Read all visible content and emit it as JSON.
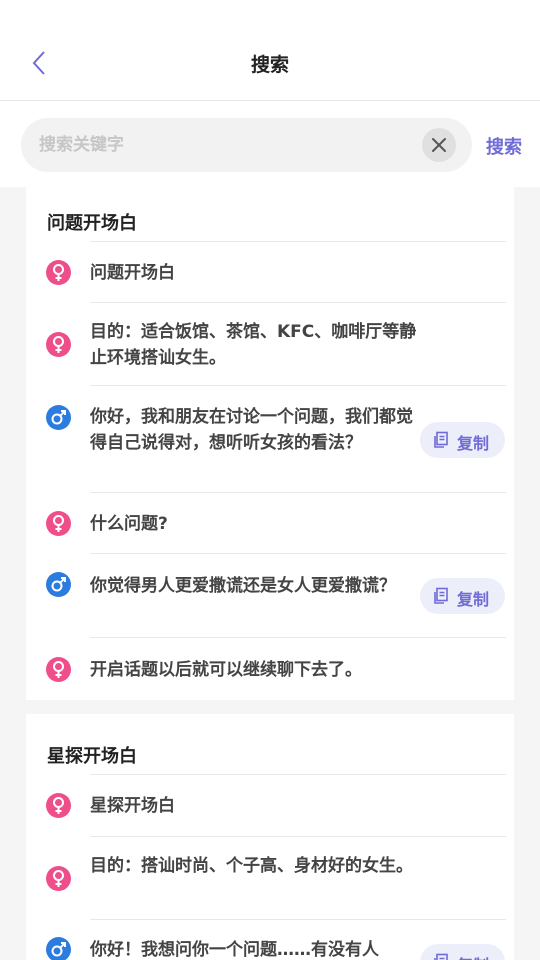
{
  "header": {
    "title": "搜索"
  },
  "search": {
    "placeholder": "搜索关键字",
    "button": "搜索"
  },
  "copy_label": "复制",
  "cards": [
    {
      "title": "问题开场白",
      "rows": [
        {
          "gender": "female",
          "text": "问题开场白"
        },
        {
          "gender": "female",
          "text": "目的：适合饭馆、茶馆、KFC、咖啡厅等静止环境搭讪女生。"
        },
        {
          "gender": "male",
          "text": "你好，我和朋友在讨论一个问题，我们都觉得自己说得对，想听听女孩的看法？"
        },
        {
          "gender": "female",
          "text": "什么问题?"
        },
        {
          "gender": "male",
          "text": "你觉得男人更爱撒谎还是女人更爱撒谎？"
        },
        {
          "gender": "female",
          "text": "开启话题以后就可以继续聊下去了。"
        }
      ]
    },
    {
      "title": "星探开场白",
      "rows": [
        {
          "gender": "female",
          "text": "星探开场白"
        },
        {
          "gender": "female",
          "text": "目的：搭讪时尚、个子高、身材好的女生。"
        },
        {
          "gender": "male",
          "text": "你好！我想问你一个问题……有没有人"
        }
      ]
    }
  ]
}
